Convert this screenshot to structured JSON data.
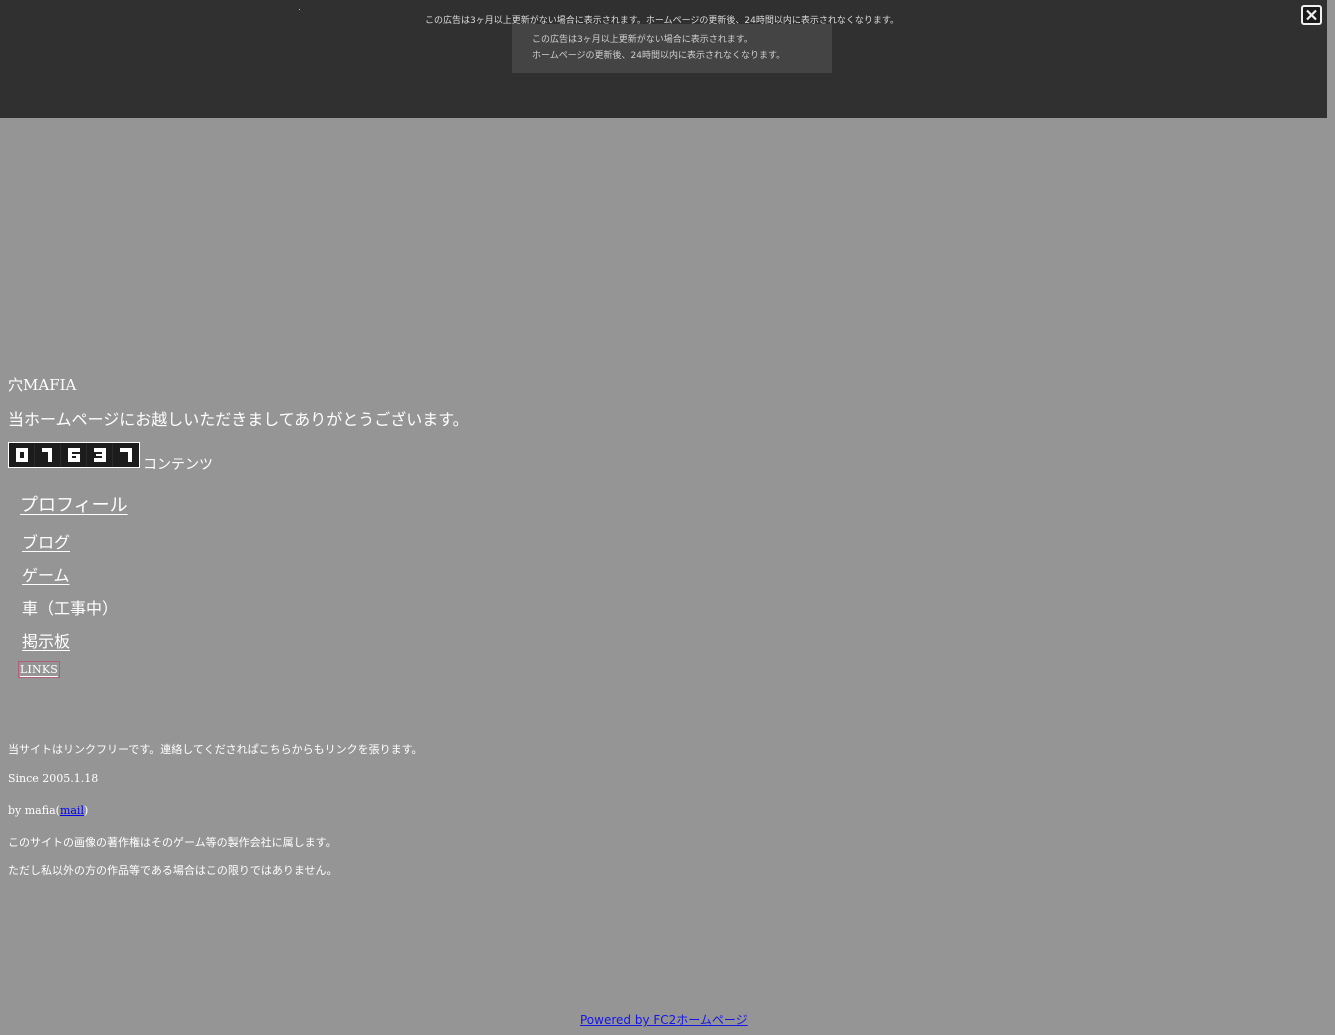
{
  "ad": {
    "notice_top": "この広告は3ヶ月以上更新がない場合に表示されます。ホームページの更新後、24時間以内に表示されなくなります。",
    "notice_line1": "この広告は3ヶ月以上更新がない場合に表示されます。",
    "notice_line2": "ホームページの更新後、24時間以内に表示されなくなります。",
    "close_icon": "close-icon"
  },
  "site": {
    "title": "穴MAFIA",
    "welcome": "当ホームページにお越しいただきましてありがとうございます。"
  },
  "counter": {
    "digits": [
      "0",
      "1",
      "6",
      "3",
      "7"
    ],
    "label": "コンテンツ"
  },
  "nav": {
    "profile": "プロフィール",
    "blog": "ブログ",
    "game": "ゲーム",
    "car": "車（工事中）",
    "bbs": "掲示板",
    "links": "LINKS"
  },
  "footer": {
    "link_free": "当サイトはリンクフリーです。連絡してくだされぱこちらからもリンクを張ります。",
    "since": "Since 2005.1.18",
    "by_prefix": "by mafia(",
    "mail_label": "mail",
    "by_suffix": ")",
    "copyright1": "このサイトの画像の著作権はそのゲーム等の製作会社に属します。",
    "copyright2": "ただし私以外の方の作品等である場合はこの限りではありません。"
  },
  "powered_by": "Powered by FC2ホームページ",
  "colors": {
    "page_background": "#959595",
    "ad_background": "#303030",
    "link_blue": "#0000ee"
  }
}
